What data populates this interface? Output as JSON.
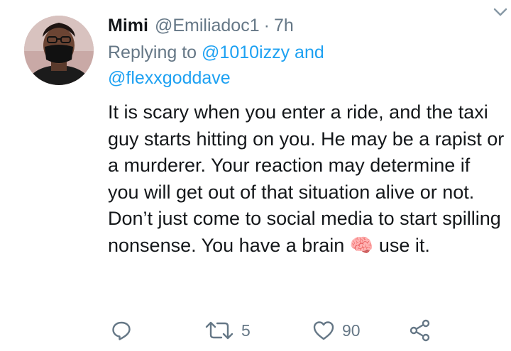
{
  "tweet": {
    "display_name": "Mimi",
    "handle": "@Emiliadoc1",
    "separator": "·",
    "time": "7h",
    "reply_prefix": "Replying to ",
    "reply_mention_1": "@1010izzy",
    "reply_conjunction": " and",
    "reply_mention_2": "@flexxgoddave",
    "body": "It is scary when you enter a ride, and the taxi guy starts hitting on you. He may be a rapist or a murderer. Your reaction may determine if you will get out of that situation alive or not. Don’t just come to social media to start spilling nonsense. You have a brain 🧠 use it."
  },
  "actions": {
    "reply_icon": "reply-icon",
    "retweet_icon": "retweet-icon",
    "retweet_count": "5",
    "like_icon": "heart-icon",
    "like_count": "90",
    "share_icon": "share-icon"
  },
  "colors": {
    "text": "#14171a",
    "muted": "#657786",
    "link": "#1da1f2"
  }
}
